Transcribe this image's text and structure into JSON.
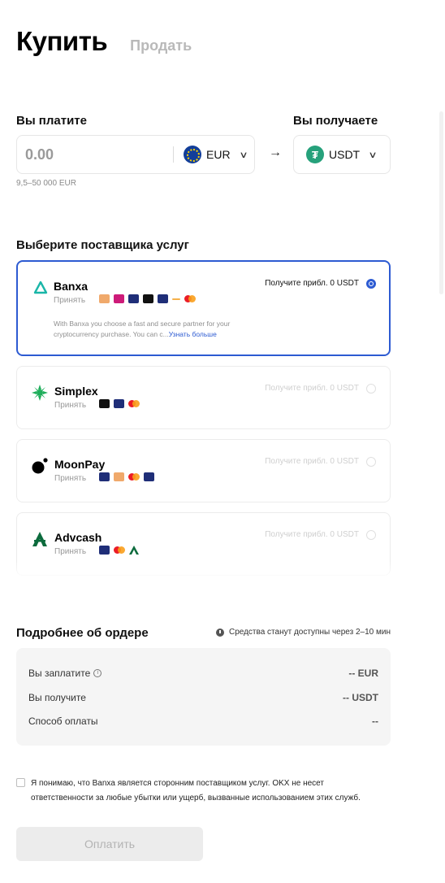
{
  "tabs": {
    "buy": "Купить",
    "sell": "Продать"
  },
  "pay": {
    "label": "Вы платите",
    "amount_placeholder": "0.00",
    "currency": "EUR",
    "range": "9,5–50 000 EUR"
  },
  "receive": {
    "label": "Вы получаете",
    "currency": "USDT",
    "currency_icon": "₮"
  },
  "arrow": "→",
  "providers": {
    "title": "Выберите поставщика услуг",
    "accept_label": "Принять",
    "items": [
      {
        "name": "Banxa",
        "quote": "Получите прибл. 0 USDT",
        "selected": true,
        "description": "With Banxa you choose a fast and secure partner for your cryptocurrency purchase. You can c...",
        "more": "Узнать больше",
        "methods": [
          "bank-card-icon",
          "ideal-icon",
          "sepa-icon",
          "apple-pay-icon",
          "visa-icon",
          "dash-icon",
          "mastercard-icon"
        ]
      },
      {
        "name": "Simplex",
        "quote": "Получите прибл. 0 USDT",
        "selected": false,
        "methods": [
          "apple-pay-icon",
          "visa-icon",
          "mastercard-icon"
        ]
      },
      {
        "name": "MoonPay",
        "quote": "Получите прибл. 0 USDT",
        "selected": false,
        "methods": [
          "visa-icon",
          "bank-card-icon",
          "mastercard-icon",
          "sepa-icon"
        ]
      },
      {
        "name": "Advcash",
        "quote": "Получите прибл. 0 USDT",
        "selected": false,
        "methods": [
          "visa-icon",
          "mastercard-icon",
          "advcash-icon"
        ]
      }
    ]
  },
  "order": {
    "title": "Подробнее об ордере",
    "note": "Средства станут доступны через 2–10 мин",
    "rows": [
      {
        "label": "Вы заплатите",
        "value": "-- EUR"
      },
      {
        "label": "Вы получите",
        "value": "-- USDT"
      },
      {
        "label": "Способ оплаты",
        "value": "--"
      }
    ]
  },
  "consent": "Я понимаю, что Banxa является сторонним поставщиком услуг. OKX не несет ответственности за любые убытки или ущерб, вызванные использованием этих служб.",
  "pay_button": "Оплатить",
  "colors": {
    "accent": "#2d5bd2",
    "usdt": "#26a17b",
    "eur": "#123e99"
  }
}
